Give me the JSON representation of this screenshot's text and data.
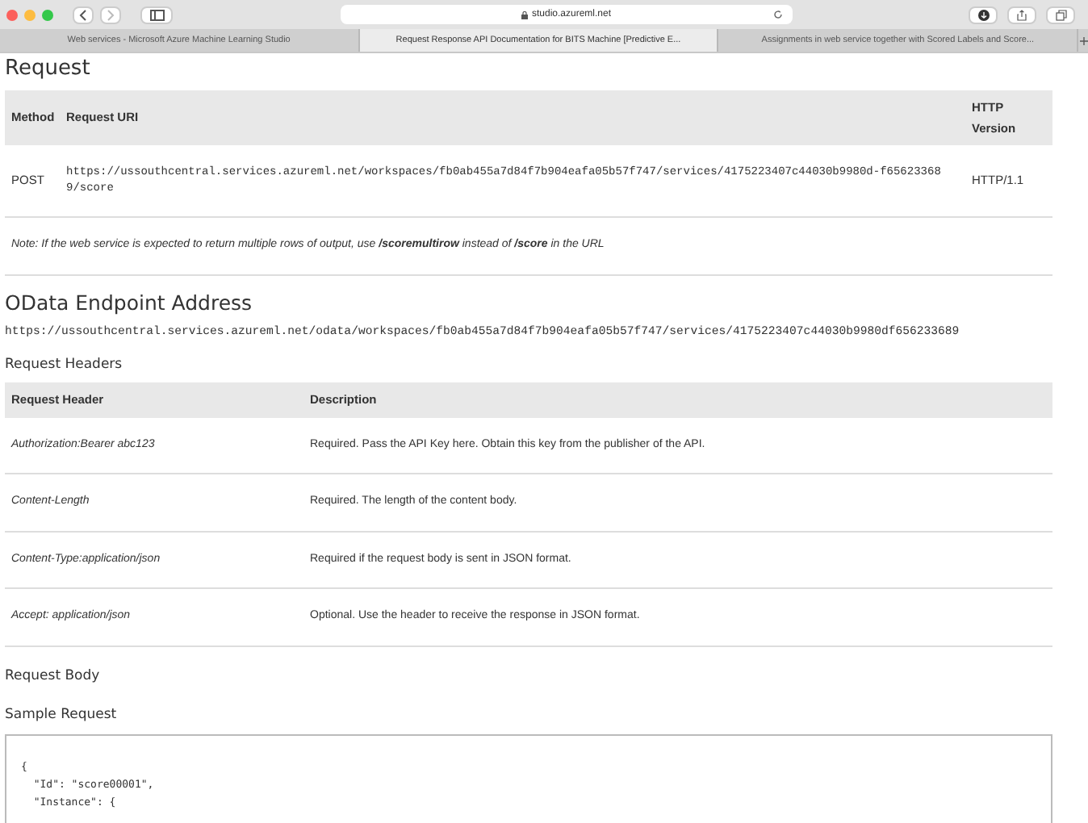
{
  "browser": {
    "address": "studio.azureml.net",
    "tabs": [
      {
        "label": "Web services - Microsoft Azure Machine Learning Studio",
        "selected": false
      },
      {
        "label": "Request Response API Documentation for BITS Machine [Predictive E...",
        "selected": true
      },
      {
        "label": "Assignments in web service together with Scored Labels and Score...",
        "selected": false
      }
    ]
  },
  "request": {
    "heading": "Request",
    "columns": [
      "Method",
      "Request URI",
      "HTTP Version"
    ],
    "row": {
      "method": "POST",
      "uri": "https://ussouthcentral.services.azureml.net/workspaces/fb0ab455a7d84f7b904eafa05b57f747/services/4175223407c44030b9980d-f656233689/score",
      "version": "HTTP/1.1"
    },
    "note": "Note: If the web service is expected to return multiple rows of output, use **/scoremultirow** instead of **/score** in the URL"
  },
  "odata": {
    "heading": "OData Endpoint Address",
    "url": "https://ussouthcentral.services.azureml.net/odata/workspaces/fb0ab455a7d84f7b904eafa05b57f747/services/4175223407c44030b9980df656233689"
  },
  "headers": {
    "heading": "Request Headers",
    "columns": [
      "Request Header",
      "Description"
    ],
    "rows": [
      {
        "header": "Authorization:Bearer abc123",
        "description": "Required. Pass the API Key here. Obtain this key from the publisher of the API."
      },
      {
        "header": "Content-Length",
        "description": "Required. The length of the content body."
      },
      {
        "header": "Content-Type:application/json",
        "description": "Required if the request body is sent in JSON format."
      },
      {
        "header": "Accept: application/json",
        "description": "Optional. Use the header to receive the response in JSON format."
      }
    ]
  },
  "body": {
    "heading": "Request Body",
    "sample_heading": "Sample Request",
    "code_lines": [
      "{",
      "  \"Id\": \"score00001\",",
      "  \"Instance\": {"
    ]
  }
}
